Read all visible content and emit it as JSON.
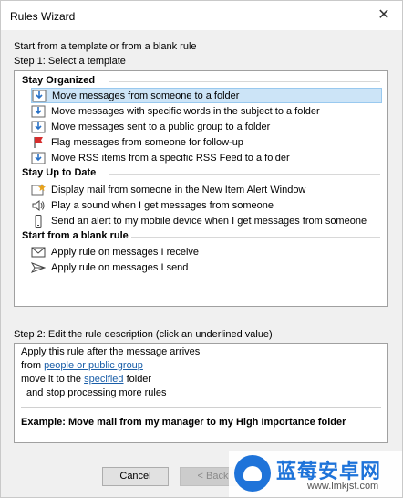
{
  "window": {
    "title": "Rules Wizard",
    "close_glyph": "✕"
  },
  "intro": "Start from a template or from a blank rule",
  "step1": "Step 1: Select a template",
  "groups": [
    {
      "label": "Stay Organized",
      "items": [
        {
          "label": "Move messages from someone to a folder",
          "icon": "move-to-folder-icon",
          "selected": true
        },
        {
          "label": "Move messages with specific words in the subject to a folder",
          "icon": "move-to-folder-icon"
        },
        {
          "label": "Move messages sent to a public group to a folder",
          "icon": "move-to-folder-icon"
        },
        {
          "label": "Flag messages from someone for follow-up",
          "icon": "flag-icon"
        },
        {
          "label": "Move RSS items from a specific RSS Feed to a folder",
          "icon": "move-to-folder-icon"
        }
      ]
    },
    {
      "label": "Stay Up to Date",
      "items": [
        {
          "label": "Display mail from someone in the New Item Alert Window",
          "icon": "alert-window-icon"
        },
        {
          "label": "Play a sound when I get messages from someone",
          "icon": "speaker-icon"
        },
        {
          "label": "Send an alert to my mobile device when I get messages from someone",
          "icon": "mobile-device-icon"
        }
      ]
    },
    {
      "label": "Start from a blank rule",
      "items": [
        {
          "label": "Apply rule on messages I receive",
          "icon": "envelope-icon"
        },
        {
          "label": "Apply rule on messages I send",
          "icon": "send-icon"
        }
      ]
    }
  ],
  "step2": "Step 2: Edit the rule description (click an underlined value)",
  "description": {
    "line1": "Apply this rule after the message arrives",
    "line2_prefix": "from ",
    "line2_link": "people or public group",
    "line3_prefix": "move it to the ",
    "line3_link": "specified",
    "line3_suffix": " folder",
    "line4": "and stop processing more rules",
    "example": "Example: Move mail from my manager to my High Importance folder"
  },
  "buttons": {
    "cancel": "Cancel",
    "back": "< Back"
  },
  "watermark": {
    "title": "蓝莓安卓网",
    "url": "www.lmkjst.com"
  },
  "colors": {
    "selection": "#cce4f7",
    "link": "#1a5ea8",
    "flag": "#d62d2d",
    "arrow": "#2a72c7"
  }
}
